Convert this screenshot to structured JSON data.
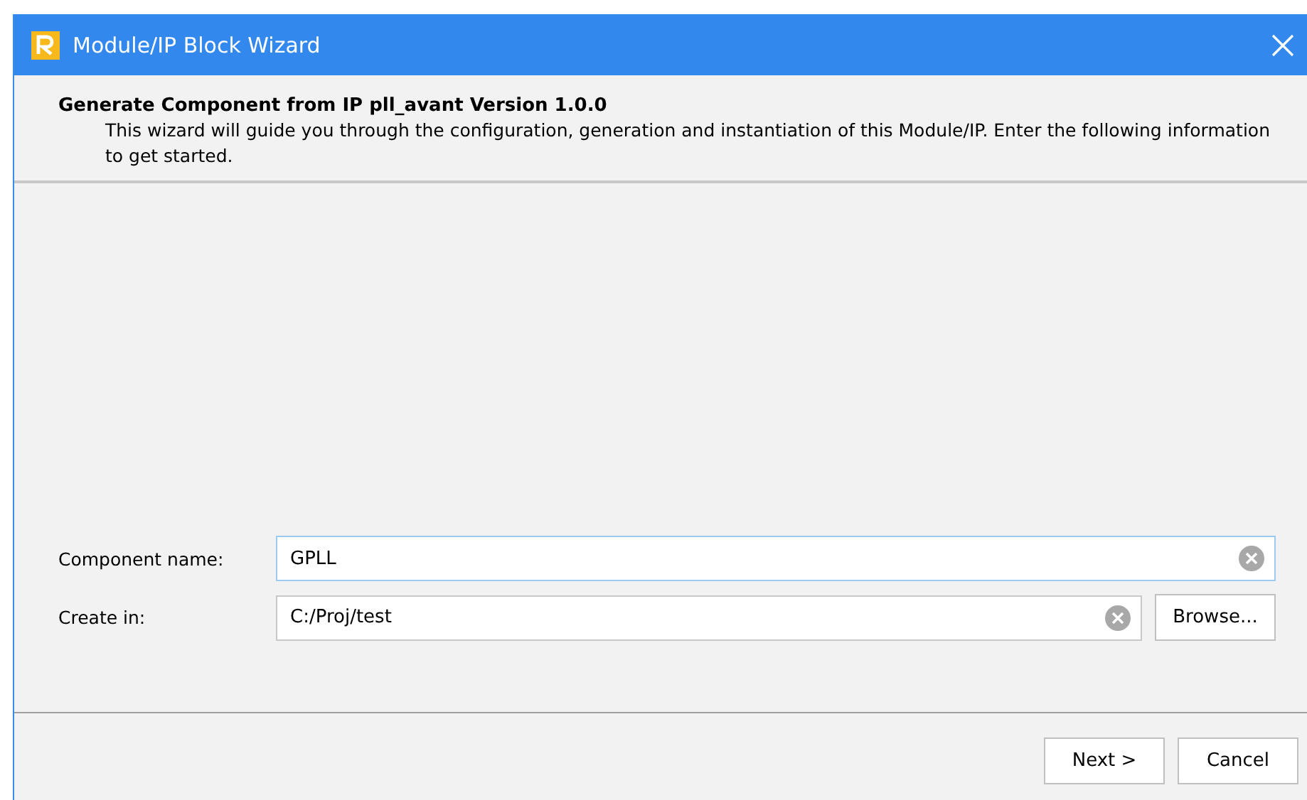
{
  "window": {
    "title": "Module/IP Block Wizard"
  },
  "header": {
    "title": "Generate Component from IP pll_avant Version 1.0.0",
    "description": "This wizard will guide you through the configuration, generation and instantiation of this Module/IP. Enter the following information to get started."
  },
  "fields": [
    {
      "label": "Component name:",
      "value": "GPLL",
      "focused": true
    },
    {
      "label": "Create in:",
      "value": "C:/Proj/test",
      "focused": false,
      "button": "Browse..."
    }
  ],
  "buttons": [
    "Next >",
    "Cancel"
  ]
}
